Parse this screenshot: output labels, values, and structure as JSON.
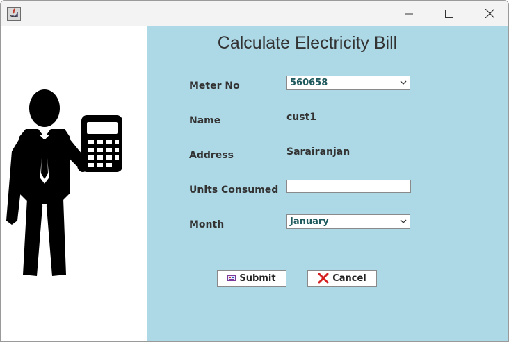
{
  "window": {
    "icon": "java-app-icon",
    "controls": [
      "minimize-icon",
      "maximize-icon",
      "close-icon"
    ]
  },
  "illustration": {
    "icon": "businessman-with-calculator-icon"
  },
  "form": {
    "title": "Calculate Electricity Bill",
    "meter_no": {
      "label": "Meter No",
      "selected": "560658"
    },
    "name": {
      "label": "Name",
      "value": "cust1"
    },
    "address": {
      "label": "Address",
      "value": "Sarairanjan"
    },
    "units": {
      "label": "Units Consumed",
      "value": ""
    },
    "month": {
      "label": "Month",
      "selected": "January"
    }
  },
  "buttons": {
    "submit": {
      "label": "Submit",
      "icon": "submit-icon"
    },
    "cancel": {
      "label": "Cancel",
      "icon": "red-x-icon"
    }
  },
  "colors": {
    "panel": "#add8e6",
    "text": "#333333",
    "combo_text": "#1f5a5e",
    "cancel_icon": "#d42020"
  }
}
